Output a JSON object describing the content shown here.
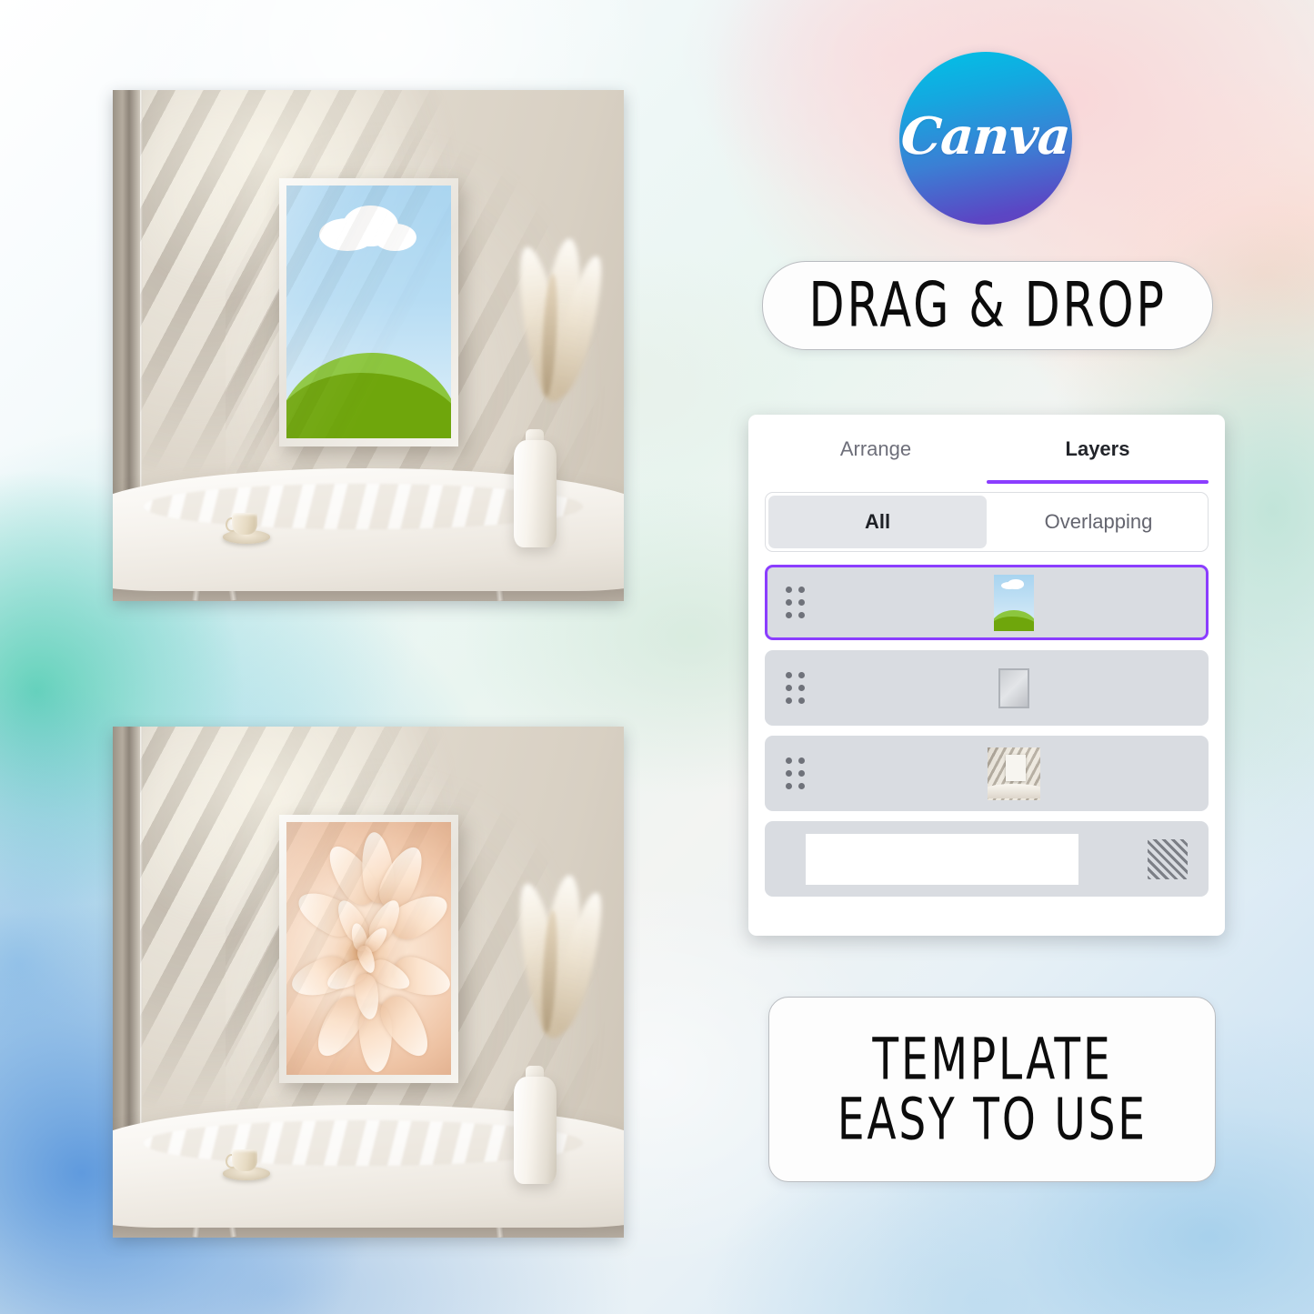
{
  "brand": {
    "logo_name": "canva-logo",
    "wordmark": "Canva",
    "gradient_top": "#00c3e6",
    "gradient_bottom": "#6540bd"
  },
  "banners": {
    "drag_drop": "DRAG & DROP",
    "template_line1": "TEMPLATE",
    "template_line2": "EASY TO USE"
  },
  "layers_panel": {
    "tabs": [
      {
        "label": "Arrange",
        "active": false
      },
      {
        "label": "Layers",
        "active": true
      }
    ],
    "accent_color": "#8b3dff",
    "filter": {
      "options": [
        {
          "label": "All",
          "active": true
        },
        {
          "label": "Overlapping",
          "active": false
        }
      ]
    },
    "rows": [
      {
        "name": "layer-row-landscape-poster",
        "thumbnail": "landscape-art-thumbnail",
        "selected": true
      },
      {
        "name": "layer-row-frame",
        "thumbnail": "frame-shape-thumbnail",
        "selected": false
      },
      {
        "name": "layer-row-room-photo",
        "thumbnail": "room-photo-thumbnail",
        "selected": false
      },
      {
        "name": "layer-row-background",
        "thumbnail": "hatched-transparency-thumbnail",
        "selected": false
      }
    ]
  },
  "mockups": [
    {
      "name": "mockup-landscape-poster",
      "artwork": "minimalist-landscape-blue-sky-white-cloud-green-hills",
      "scene": "beige-wall-with-blind-shadows-marble-table-coffee-cup-pampas-vase"
    },
    {
      "name": "mockup-flower-poster",
      "artwork": "peach-dahlia-flower-closeup",
      "scene": "beige-wall-with-blind-shadows-marble-table-coffee-cup-pampas-vase"
    }
  ],
  "background": {
    "style": "watercolor-wash",
    "colors": [
      "#ffffff",
      "#fadcd8",
      "#f7cdb4",
      "#bae2d4",
      "#56ceb4",
      "#5694dc",
      "#9eccea"
    ]
  }
}
